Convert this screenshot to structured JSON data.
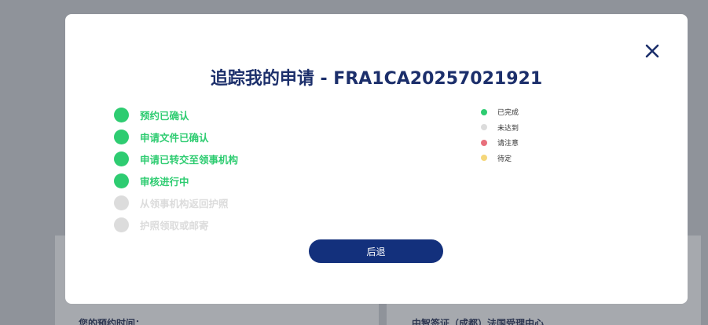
{
  "modal": {
    "title": "追踪我的申请 - FRA1CA20257021921",
    "back_label": "后退"
  },
  "colors": {
    "done": "#2ecc71",
    "pending": "#dcdcdc",
    "attention": "#e8707c",
    "tbd": "#f5d77a",
    "title": "#1c2f6b",
    "button": "#13307c"
  },
  "steps": [
    {
      "label": "预约已确认",
      "status": "done"
    },
    {
      "label": "申请文件已确认",
      "status": "done"
    },
    {
      "label": "申请已转交至领事机构",
      "status": "done"
    },
    {
      "label": "审核进行中",
      "status": "done"
    },
    {
      "label": "从领事机构返回护照",
      "status": "pending"
    },
    {
      "label": "护照领取或邮寄",
      "status": "pending"
    }
  ],
  "legend": [
    {
      "label": "已完成",
      "status": "done"
    },
    {
      "label": "未达到",
      "status": "pending"
    },
    {
      "label": "请注意",
      "status": "attention"
    },
    {
      "label": "待定",
      "status": "tbd"
    }
  ],
  "background": {
    "left_label": "您的预约时间：",
    "right_label": "中智签证（成都）法国受理中心"
  }
}
